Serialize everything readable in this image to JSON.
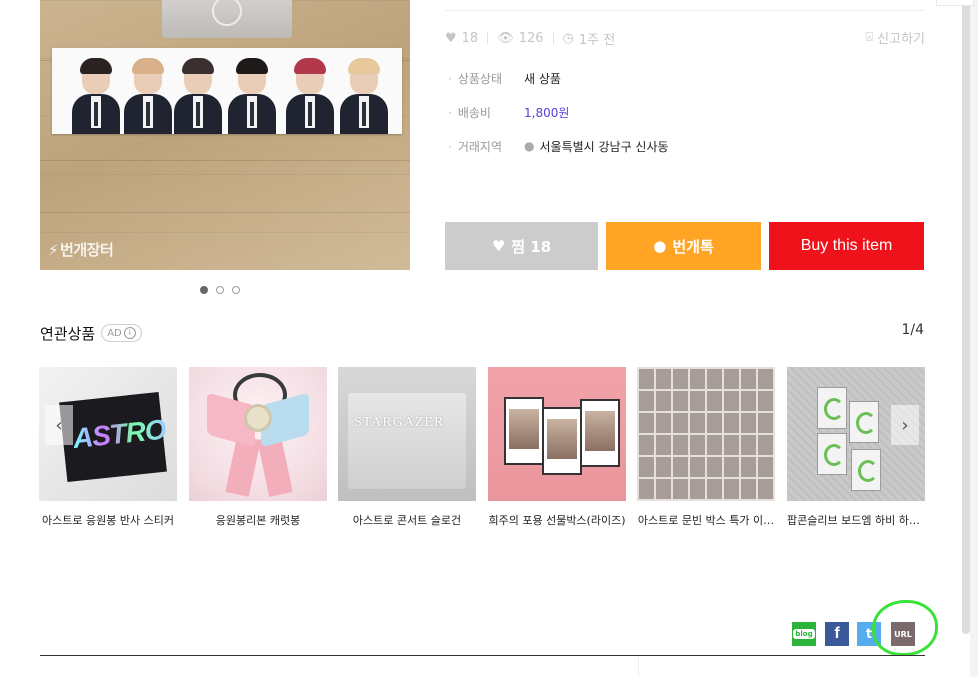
{
  "product": {
    "image_watermark": "번개장터",
    "carousel_dots": 3,
    "carousel_active": 1
  },
  "stats": {
    "likes": "18",
    "views": "126",
    "time": "1주 전",
    "report": "신고하기"
  },
  "info": {
    "condition_label": "상품상태",
    "condition_value": "새 상품",
    "shipping_label": "배송비",
    "shipping_value": "1,800원",
    "location_label": "거래지역",
    "location_value": "서울특별시 강남구 신사동"
  },
  "buttons": {
    "like": "찜 18",
    "talk": "번개톡",
    "buy": "Buy this item"
  },
  "related": {
    "title": "연관상품",
    "ad": "AD",
    "ad_info": "i",
    "page": "1/4",
    "items": [
      {
        "name": "아스트로 응원봉 반사 스티커",
        "art": "ASTRO"
      },
      {
        "name": "응원봉리본 캐럿봉"
      },
      {
        "name": "아스트로 콘서트 슬로건",
        "art": "STARGAZER"
      },
      {
        "name": "희주의 포용 선물박스(라이즈)"
      },
      {
        "name": "아스트로 문빈 박스 특가 이…"
      },
      {
        "name": "팝콘슬리브 보드엠 하비 하드…"
      }
    ]
  },
  "share": {
    "blog": "blog",
    "facebook": "f",
    "twitter": "t",
    "url": "URL",
    "highlight_color": "#39e23a"
  },
  "colors": {
    "like_btn": "#cccccc",
    "talk_btn": "#ffa424",
    "buy_btn": "#f0121a",
    "price": "#5a3fd6"
  }
}
